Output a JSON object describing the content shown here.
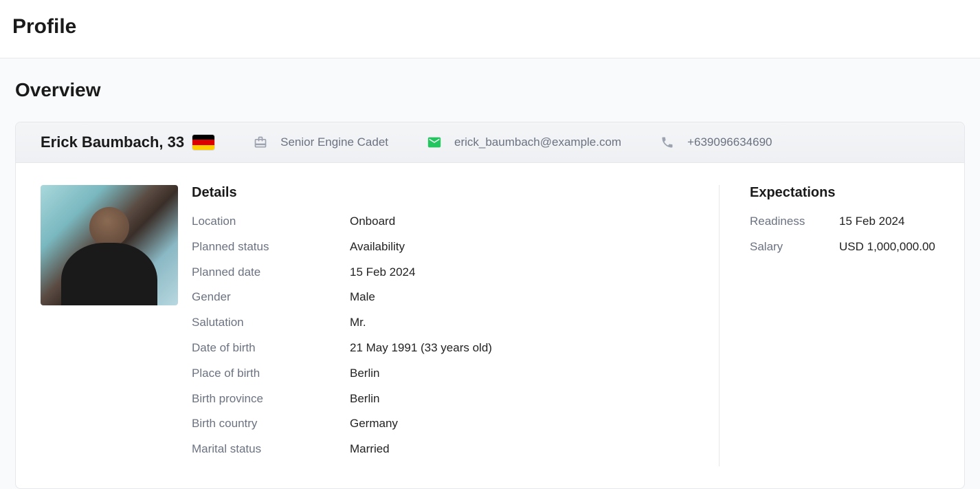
{
  "page": {
    "title": "Profile"
  },
  "section": {
    "heading": "Overview"
  },
  "header": {
    "name": "Erick Baumbach, 33",
    "flag": "germany-flag",
    "role": "Senior Engine Cadet",
    "email": "erick_baumbach@example.com",
    "phone": "+639096634690"
  },
  "details": {
    "heading": "Details",
    "fields": [
      {
        "label": "Location",
        "value": "Onboard"
      },
      {
        "label": "Planned status",
        "value": "Availability"
      },
      {
        "label": "Planned date",
        "value": "15 Feb 2024"
      },
      {
        "label": "Gender",
        "value": "Male"
      },
      {
        "label": "Salutation",
        "value": "Mr."
      },
      {
        "label": "Date of birth",
        "value": "21 May 1991 (33 years old)"
      },
      {
        "label": "Place of birth",
        "value": "Berlin"
      },
      {
        "label": "Birth province",
        "value": "Berlin"
      },
      {
        "label": "Birth country",
        "value": "Germany"
      },
      {
        "label": "Marital status",
        "value": "Married"
      }
    ]
  },
  "expectations": {
    "heading": "Expectations",
    "fields": [
      {
        "label": "Readiness",
        "value": "15 Feb 2024"
      },
      {
        "label": "Salary",
        "value": "USD 1,000,000.00"
      }
    ]
  }
}
